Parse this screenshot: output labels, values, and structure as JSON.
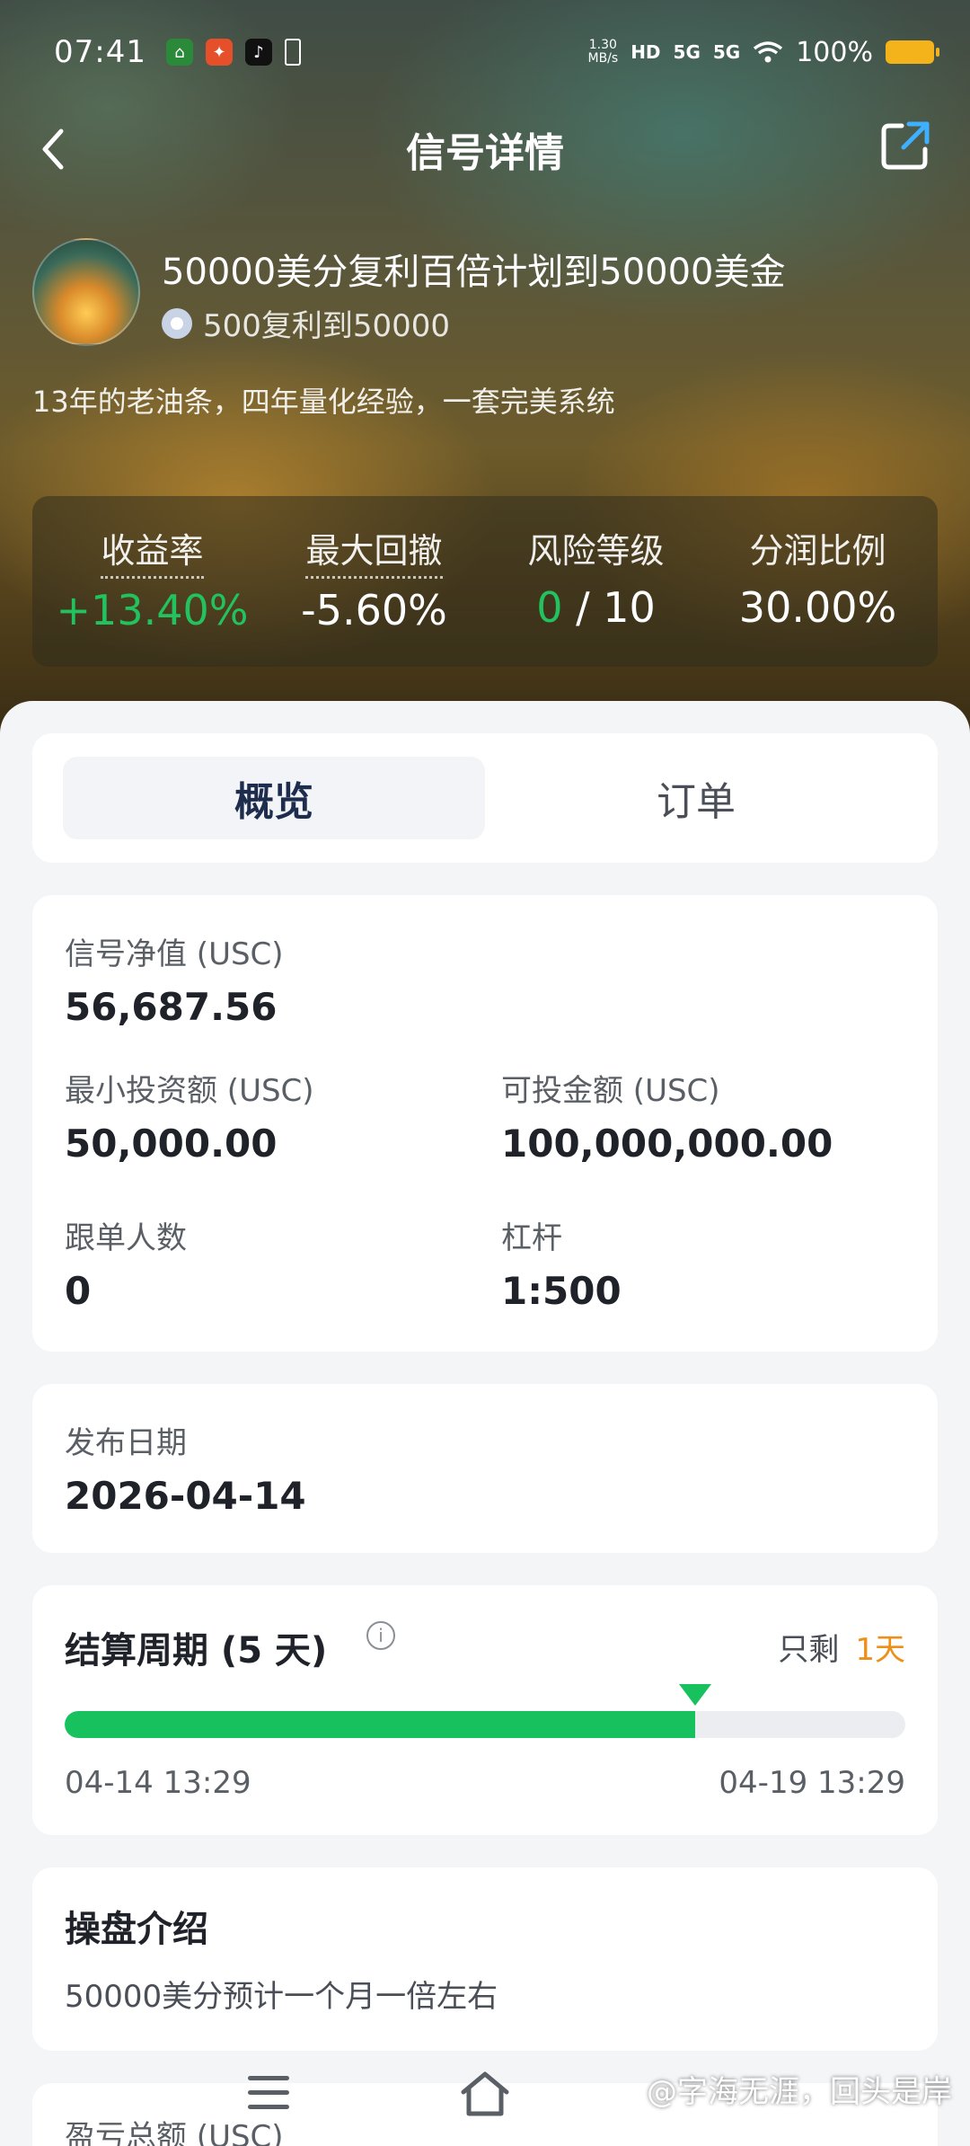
{
  "status_bar": {
    "time": "07:41",
    "net_speed_value": "1.30",
    "net_speed_unit": "MB/s",
    "hd": "HD",
    "sig1": "5G",
    "sig2": "5G",
    "battery": "100%"
  },
  "nav": {
    "title": "信号详情"
  },
  "signal": {
    "name": "50000美分复利百倍计划到50000美金",
    "author": "500复利到50000",
    "description": "13年的老油条，四年量化经验，一套完美系统"
  },
  "stats": [
    {
      "label": "收益率",
      "value": "+13.40%"
    },
    {
      "label": "最大回撤",
      "value": "-5.60%"
    },
    {
      "label": "风险等级",
      "value_highlight": "0",
      "value_rest": " / 10"
    },
    {
      "label": "分润比例",
      "value": "30.00%"
    }
  ],
  "tabs": [
    {
      "label": "概览"
    },
    {
      "label": "订单"
    }
  ],
  "info": {
    "net_value_label": "信号净值 (USC)",
    "net_value": "56,687.56",
    "min_invest_label": "最小投资额 (USC)",
    "min_invest": "50,000.00",
    "available_label": "可投金额 (USC)",
    "available": "100,000,000.00",
    "followers_label": "跟单人数",
    "followers": "0",
    "leverage_label": "杠杆",
    "leverage": "1:500"
  },
  "publish": {
    "label": "发布日期",
    "value": "2026-04-14"
  },
  "period": {
    "title": "结算周期 (5 天)",
    "remaining_label": "只剩",
    "remaining_value": "1天",
    "start": "04-14 13:29",
    "end": "04-19 13:29",
    "progress_fraction": 0.75
  },
  "intro": {
    "title": "操盘介绍",
    "text": "50000美分预计一个月一倍左右"
  },
  "pnl": {
    "label": "盈亏总额 (USC)"
  },
  "watermark": "@字海无涯，回头是岸",
  "colors": {
    "green": "#16c15e",
    "orange": "#ee8f1c",
    "active_tab_text": "#1e2d4d"
  }
}
